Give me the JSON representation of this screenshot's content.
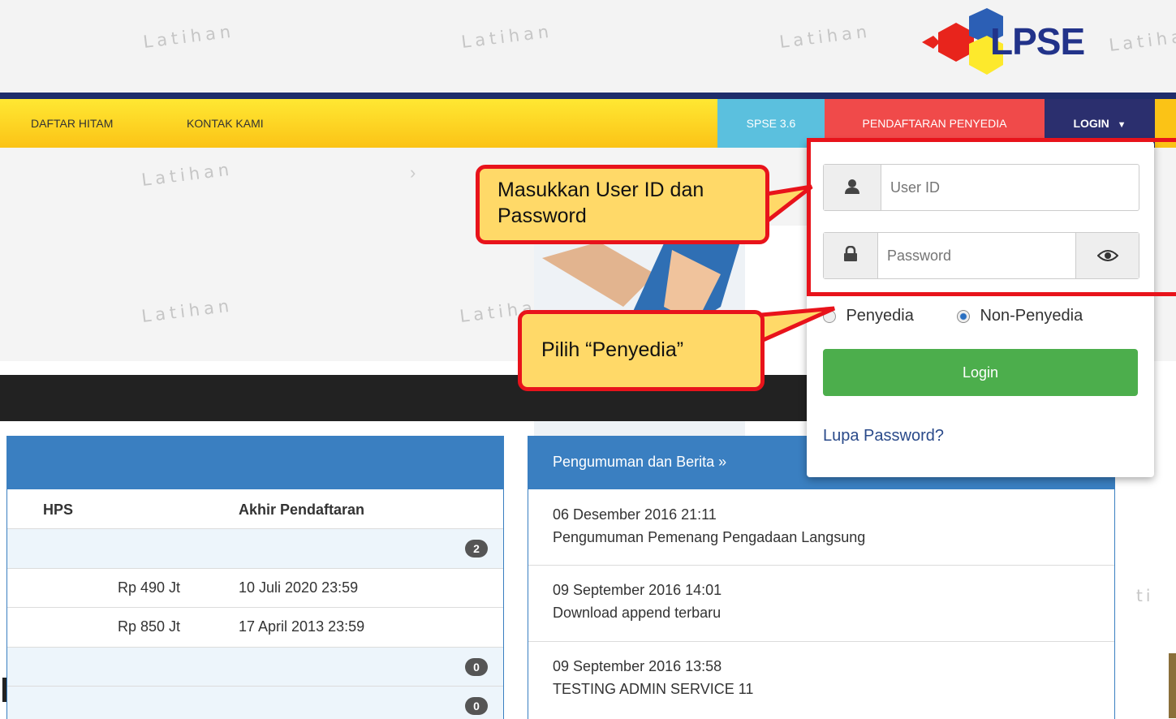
{
  "header": {
    "watermark": "Latihan",
    "logo_text": "LPSE"
  },
  "nav": {
    "items": [
      "DAFTAR HITAM",
      "KONTAK KAMI"
    ],
    "spse": "SPSE 3.6",
    "register": "PENDAFTARAN PENYEDIA",
    "login": "LOGIN",
    "colors": {
      "dark_blue": "#1f2d6b",
      "yellow": "#fbc316",
      "cyan": "#5bc0de",
      "red": "#f04a4a"
    }
  },
  "login_form": {
    "user_placeholder": "User ID",
    "password_placeholder": "Password",
    "radio_penyedia": "Penyedia",
    "radio_non_penyedia": "Non-Penyedia",
    "selected": "Non-Penyedia",
    "login_button": "Login",
    "forgot_link": "Lupa Password?",
    "colors": {
      "login_button": "#4cae4c",
      "link": "#2a4a8a"
    }
  },
  "callouts": {
    "credentials": "Masukkan User ID dan Password",
    "choose": "Pilih “Penyedia”"
  },
  "lelang": {
    "headers": [
      "HPS",
      "Akhir Pendaftaran"
    ],
    "rows": [
      {
        "badge": "2"
      },
      {
        "hps": "Rp 490 Jt",
        "akhir": "10 Juli 2020 23:59"
      },
      {
        "hps": "Rp 850 Jt",
        "akhir": "17 April 2013 23:59"
      },
      {
        "badge": "0"
      },
      {
        "badge": "0"
      }
    ]
  },
  "news": {
    "title": "Pengumuman dan Berita »",
    "items": [
      {
        "date": "06 Desember 2016 21:11",
        "title": "Pengumuman Pemenang Pengadaan Langsung"
      },
      {
        "date": "09 September 2016 14:01",
        "title": "Download append terbaru"
      },
      {
        "date": "09 September 2016 13:58",
        "title": "TESTING ADMIN SERVICE 11"
      }
    ]
  }
}
